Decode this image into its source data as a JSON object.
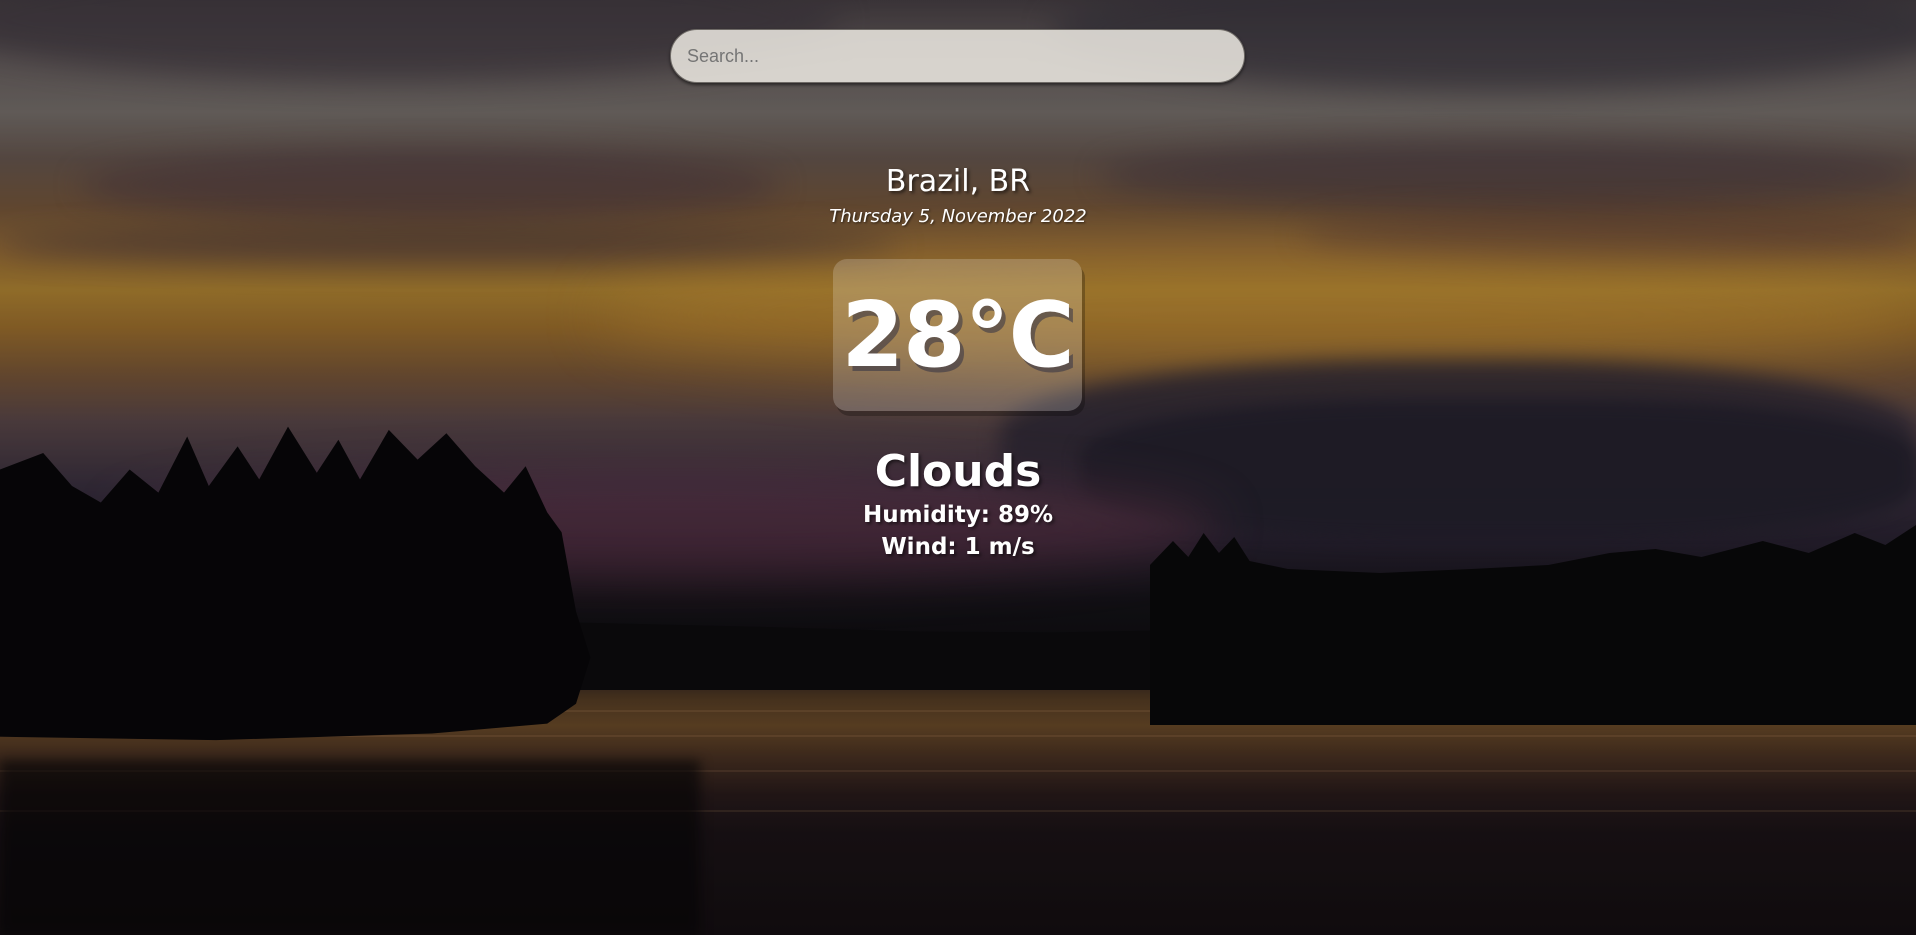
{
  "search": {
    "placeholder": "Search...",
    "value": ""
  },
  "location": {
    "city": "Brazil, BR",
    "date": "Thursday 5, November 2022"
  },
  "current": {
    "temperature": "28°C",
    "condition": "Clouds",
    "humidity": "Humidity: 89%",
    "wind": "Wind: 1 m/s"
  },
  "background": {
    "scene": "sunset-lake-forest",
    "colors": {
      "sky_top": "#4a4247",
      "sky_glow": "#b88a35",
      "treeline": "#080709",
      "water": "#6e4d2a"
    }
  }
}
